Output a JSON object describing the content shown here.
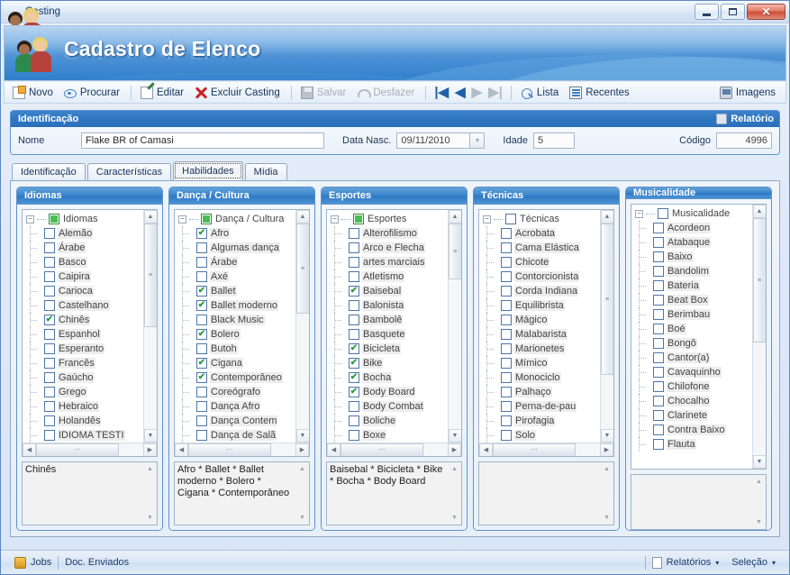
{
  "window": {
    "title": "Casting",
    "icon": "people-icon",
    "buttons": {
      "minimize": "minimize",
      "maximize": "maximize",
      "close": "close"
    }
  },
  "banner": {
    "title": "Cadastro de Elenco",
    "icon": "people-icon"
  },
  "toolbar": {
    "items": [
      {
        "label": "Novo",
        "icon": "new-icon",
        "disabled": false
      },
      {
        "label": "Procurar",
        "icon": "search-icon",
        "disabled": false
      },
      {
        "label": "Editar",
        "icon": "edit-icon",
        "disabled": false
      },
      {
        "label": "Excluir Casting",
        "icon": "delete-icon",
        "disabled": false
      },
      {
        "label": "Salvar",
        "icon": "save-icon",
        "disabled": true
      },
      {
        "label": "Desfazer",
        "icon": "undo-icon",
        "disabled": true
      },
      {
        "label": "Lista",
        "icon": "list-icon",
        "disabled": false
      },
      {
        "label": "Recentes",
        "icon": "recent-icon",
        "disabled": false
      },
      {
        "label": "Imagens",
        "icon": "images-icon",
        "disabled": false
      }
    ],
    "nav": {
      "first": "|◀",
      "prev": "◀",
      "next": "▶",
      "last": "▶|"
    }
  },
  "identification": {
    "group_title": "Identificação",
    "report_label": "Relatório",
    "report_checked": false,
    "fields": {
      "nome_label": "Nome",
      "nome_value": "Flake BR of Camasi",
      "data_label": "Data Nasc.",
      "data_value": "09/11/2010",
      "idade_label": "Idade",
      "idade_value": "5",
      "codigo_label": "Código",
      "codigo_value": "4996"
    }
  },
  "tabs": [
    {
      "label": "Identificação",
      "active": false
    },
    {
      "label": "Características",
      "active": false
    },
    {
      "label": "Habilidades",
      "active": true
    },
    {
      "label": "Mídia",
      "active": false
    }
  ],
  "panels": [
    {
      "title": "Idiomas",
      "root": {
        "label": "Idiomas",
        "state": "partial"
      },
      "items": [
        {
          "label": "Alemão",
          "checked": false
        },
        {
          "label": "Árabe",
          "checked": false
        },
        {
          "label": "Basco",
          "checked": false
        },
        {
          "label": "Caipira",
          "checked": false
        },
        {
          "label": "Carioca",
          "checked": false
        },
        {
          "label": "Castelhano",
          "checked": false
        },
        {
          "label": "Chinês",
          "checked": true
        },
        {
          "label": "Espanhol",
          "checked": false
        },
        {
          "label": "Esperanto",
          "checked": false
        },
        {
          "label": "Francês",
          "checked": false
        },
        {
          "label": "Gaúcho",
          "checked": false
        },
        {
          "label": "Grego",
          "checked": false
        },
        {
          "label": "Hebraico",
          "checked": false
        },
        {
          "label": "Holandês",
          "checked": false
        },
        {
          "label": "IDIOMA TESTI",
          "checked": false
        }
      ],
      "summary": "Chinês",
      "has_hscroll": true
    },
    {
      "title": "Dança / Cultura",
      "root": {
        "label": "Dança / Cultura",
        "state": "partial"
      },
      "items": [
        {
          "label": "Afro",
          "checked": true
        },
        {
          "label": "Algumas dança",
          "checked": false
        },
        {
          "label": "Árabe",
          "checked": false
        },
        {
          "label": "Axé",
          "checked": false
        },
        {
          "label": "Ballet",
          "checked": true
        },
        {
          "label": "Ballet moderno",
          "checked": true
        },
        {
          "label": "Black Music",
          "checked": false
        },
        {
          "label": "Bolero",
          "checked": true
        },
        {
          "label": "Butoh",
          "checked": false
        },
        {
          "label": "Cigana",
          "checked": true
        },
        {
          "label": "Contemporâneo",
          "checked": true
        },
        {
          "label": "Coreógrafo",
          "checked": false
        },
        {
          "label": "Dança Afro",
          "checked": false
        },
        {
          "label": "Dança Contem",
          "checked": false
        },
        {
          "label": "Dança de Salã",
          "checked": false
        }
      ],
      "summary": "Afro * Ballet * Ballet moderno * Bolero * Cigana * Contemporâneo",
      "has_hscroll": true
    },
    {
      "title": "Esportes",
      "root": {
        "label": "Esportes",
        "state": "partial"
      },
      "items": [
        {
          "label": "Alterofilismo",
          "checked": false
        },
        {
          "label": "Arco e Flecha",
          "checked": false
        },
        {
          "label": "artes marciais",
          "checked": false
        },
        {
          "label": "Atletismo",
          "checked": false
        },
        {
          "label": "Baisebal",
          "checked": true
        },
        {
          "label": "Balonista",
          "checked": false
        },
        {
          "label": "Bambolê",
          "checked": false
        },
        {
          "label": "Basquete",
          "checked": false
        },
        {
          "label": "Bicicleta",
          "checked": true
        },
        {
          "label": "Bike",
          "checked": true
        },
        {
          "label": "Bocha",
          "checked": true
        },
        {
          "label": "Body Board",
          "checked": true
        },
        {
          "label": "Body Combat",
          "checked": false
        },
        {
          "label": "Boliche",
          "checked": false
        },
        {
          "label": "Boxe",
          "checked": false
        }
      ],
      "summary": "Baisebal * Bicicleta * Bike * Bocha * Body Board",
      "has_hscroll": true
    },
    {
      "title": "Técnicas",
      "root": {
        "label": "Técnicas",
        "state": "empty"
      },
      "items": [
        {
          "label": "Acrobata",
          "checked": false
        },
        {
          "label": "Cama Elástica",
          "checked": false
        },
        {
          "label": "Chicote",
          "checked": false
        },
        {
          "label": "Contorcionista",
          "checked": false
        },
        {
          "label": "Corda Indiana",
          "checked": false
        },
        {
          "label": "Equilibrista",
          "checked": false
        },
        {
          "label": "Mágico",
          "checked": false
        },
        {
          "label": "Malabarista",
          "checked": false
        },
        {
          "label": "Marionetes",
          "checked": false
        },
        {
          "label": "Mímico",
          "checked": false
        },
        {
          "label": "Monociclo",
          "checked": false
        },
        {
          "label": "Palhaço",
          "checked": false
        },
        {
          "label": "Perna-de-pau",
          "checked": false
        },
        {
          "label": "Pirofagia",
          "checked": false
        },
        {
          "label": "Solo",
          "checked": false
        }
      ],
      "summary": "",
      "has_hscroll": true
    },
    {
      "title": "Musicalidade",
      "root": {
        "label": "Musicalidade",
        "state": "empty"
      },
      "items": [
        {
          "label": "Acordeon",
          "checked": false
        },
        {
          "label": "Atabaque",
          "checked": false
        },
        {
          "label": "Baixo",
          "checked": false
        },
        {
          "label": "Bandolim",
          "checked": false
        },
        {
          "label": "Bateria",
          "checked": false
        },
        {
          "label": "Beat Box",
          "checked": false
        },
        {
          "label": "Berimbau",
          "checked": false
        },
        {
          "label": "Boé",
          "checked": false
        },
        {
          "label": "Bongô",
          "checked": false
        },
        {
          "label": "Cantor(a)",
          "checked": false
        },
        {
          "label": "Cavaquinho",
          "checked": false
        },
        {
          "label": "Chilofone",
          "checked": false
        },
        {
          "label": "Chocalho",
          "checked": false
        },
        {
          "label": "Clarinete",
          "checked": false
        },
        {
          "label": "Contra Baixo",
          "checked": false
        },
        {
          "label": "Flauta",
          "checked": false
        }
      ],
      "summary": "",
      "has_hscroll": false
    }
  ],
  "statusbar": {
    "left": [
      {
        "label": "Jobs",
        "icon": "jobs-icon"
      },
      {
        "label": "Doc. Enviados",
        "icon": null
      }
    ],
    "right": [
      {
        "label": "Relatórios",
        "icon": "report-icon",
        "caret": "▾"
      },
      {
        "label": "Seleção",
        "icon": null,
        "caret": "▾"
      }
    ]
  },
  "colors": {
    "accent": "#2f79c4",
    "header_blue": "#3a86cd",
    "check_green": "#2c9a3f",
    "close_red": "#cf4b35"
  }
}
